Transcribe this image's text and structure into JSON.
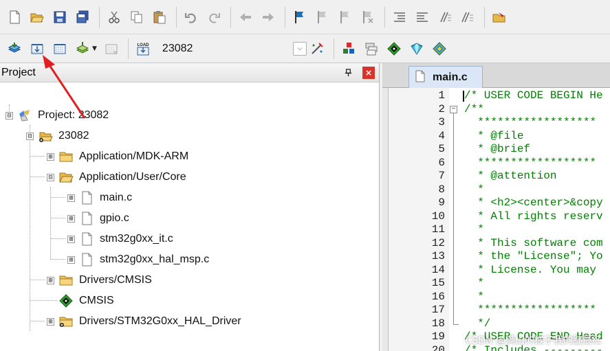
{
  "toolbar1": {
    "buttons": [
      "new-file-icon",
      "open-file-icon",
      "save-icon",
      "save-all-icon",
      "cut-icon",
      "copy-icon",
      "paste-icon",
      "undo-icon",
      "redo-icon",
      "navigate-back-icon",
      "navigate-forward-icon",
      "insert-bookmark-icon",
      "previous-bookmark-icon",
      "next-bookmark-icon",
      "clear-bookmarks-icon",
      "indent-icon",
      "unindent-icon",
      "comment-icon",
      "uncomment-icon",
      "find-in-files-icon"
    ]
  },
  "toolbar2": {
    "target_value": "23082",
    "buttons": [
      "translate-icon",
      "build-icon",
      "rebuild-icon",
      "batch-build-icon",
      "stop-build-icon",
      "download-icon",
      "options-for-target-icon",
      "manage-components-icon",
      "manage-rte-icon",
      "select-pack-icon",
      "pack-installer-icon"
    ],
    "download_label": "LOAD"
  },
  "project_panel": {
    "title": "Project",
    "pin_glyph": "⊥",
    "close_glyph": "×",
    "tree": [
      {
        "label": "Project: 23082",
        "icon": "project-icon",
        "expander": "⊟"
      },
      {
        "label": "23082",
        "icon": "target-folder-icon",
        "expander": "⊟"
      },
      {
        "label": "Application/MDK-ARM",
        "icon": "folder-icon",
        "expander": "⊞"
      },
      {
        "label": "Application/User/Core",
        "icon": "folder-open-icon",
        "expander": "⊟"
      },
      {
        "label": "main.c",
        "icon": "c-file-icon",
        "expander": "⊞"
      },
      {
        "label": "gpio.c",
        "icon": "c-file-icon",
        "expander": "⊞"
      },
      {
        "label": "stm32g0xx_it.c",
        "icon": "c-file-icon",
        "expander": "⊞"
      },
      {
        "label": "stm32g0xx_hal_msp.c",
        "icon": "c-file-icon",
        "expander": "⊞"
      },
      {
        "label": "Drivers/CMSIS",
        "icon": "folder-icon",
        "expander": "⊞"
      },
      {
        "label": "CMSIS",
        "icon": "cmsis-component-icon",
        "expander": ""
      },
      {
        "label": "Drivers/STM32G0xx_HAL_Driver",
        "icon": "hal-folder-icon",
        "expander": "⊞"
      }
    ]
  },
  "editor": {
    "tab_label": "main.c",
    "lines": [
      {
        "n": "1",
        "text": "/* USER CODE BEGIN He"
      },
      {
        "n": "2",
        "text": "/**"
      },
      {
        "n": "3",
        "text": "  ******************"
      },
      {
        "n": "4",
        "text": "  * @file           "
      },
      {
        "n": "5",
        "text": "  * @brief          "
      },
      {
        "n": "6",
        "text": "  ******************"
      },
      {
        "n": "7",
        "text": "  * @attention"
      },
      {
        "n": "8",
        "text": "  *"
      },
      {
        "n": "9",
        "text": "  * <h2><center>&copy"
      },
      {
        "n": "10",
        "text": "  * All rights reserv"
      },
      {
        "n": "11",
        "text": "  *"
      },
      {
        "n": "12",
        "text": "  * This software com"
      },
      {
        "n": "13",
        "text": "  * the \"License\"; Yo"
      },
      {
        "n": "14",
        "text": "  * License. You may"
      },
      {
        "n": "15",
        "text": "  *"
      },
      {
        "n": "16",
        "text": "  *"
      },
      {
        "n": "17",
        "text": "  ******************"
      },
      {
        "n": "18",
        "text": "  */"
      },
      {
        "n": "19",
        "text": "/* USER CODE END Head"
      },
      {
        "n": "20",
        "text": "/* Includes ---------"
      }
    ]
  },
  "watermark": "CSDN @满山的猴子我的腚最红",
  "colors": {
    "comment_green": "#008000",
    "annotation_red": "#e02020",
    "close_red": "#d9342b"
  }
}
